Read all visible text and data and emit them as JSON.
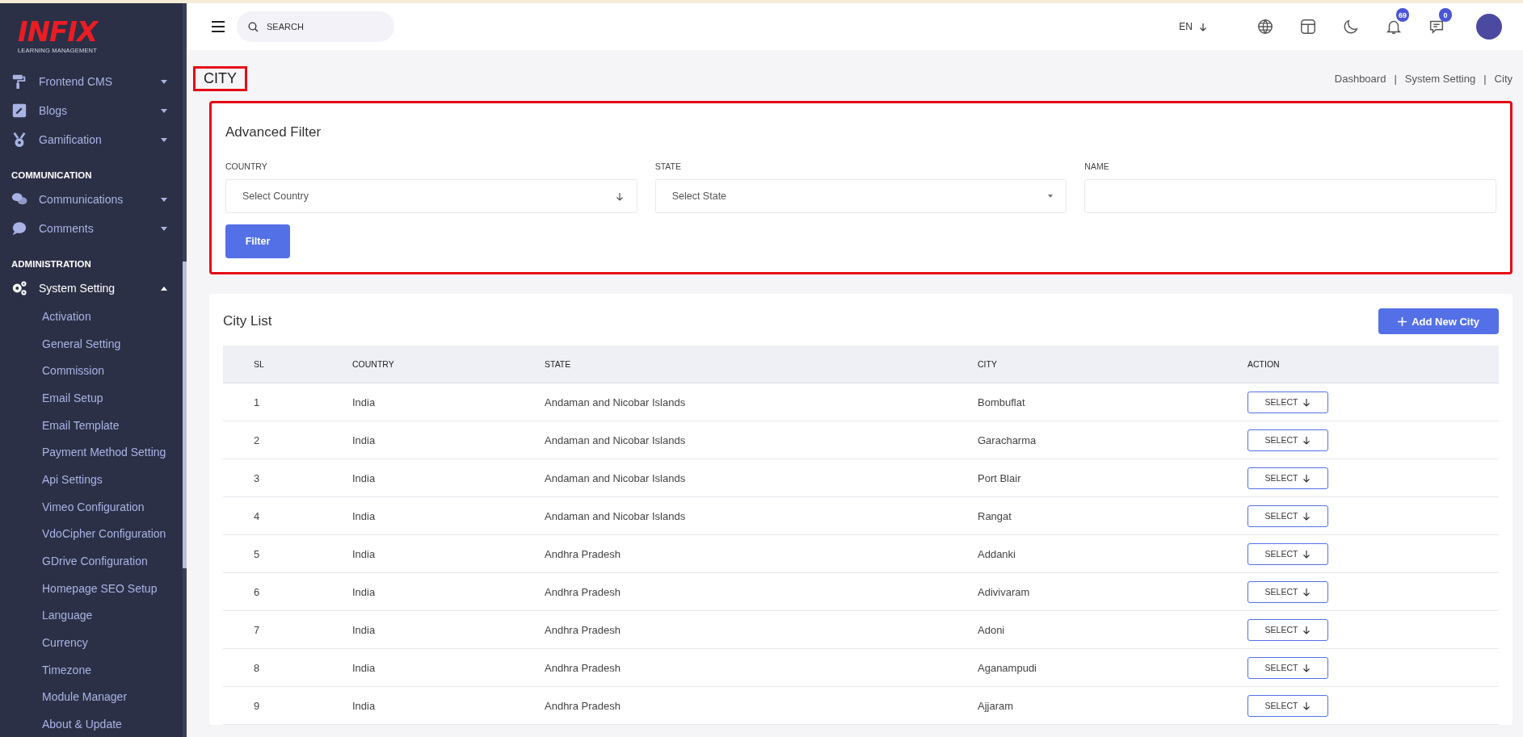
{
  "logo": {
    "wordmark": "INFIX",
    "tagline": "LEARNING MANAGEMENT"
  },
  "sidebar": {
    "sections": [
      {
        "items": [
          {
            "label": "Frontend CMS",
            "expanded": false
          },
          {
            "label": "Blogs",
            "expanded": false
          },
          {
            "label": "Gamification",
            "expanded": false
          }
        ]
      },
      {
        "heading": "COMMUNICATION",
        "items": [
          {
            "label": "Communications",
            "expanded": false
          },
          {
            "label": "Comments",
            "expanded": false
          }
        ]
      },
      {
        "heading": "ADMINISTRATION",
        "items": [
          {
            "label": "System Setting",
            "expanded": true,
            "children": [
              "Activation",
              "General Setting",
              "Commission",
              "Email Setup",
              "Email Template",
              "Payment Method Setting",
              "Api Settings",
              "Vimeo Configuration",
              "VdoCipher Configuration",
              "GDrive Configuration",
              "Homepage SEO Setup",
              "Language",
              "Currency",
              "Timezone",
              "Module Manager",
              "About & Update"
            ]
          }
        ]
      }
    ]
  },
  "header": {
    "search": {
      "placeholder": "SEARCH"
    },
    "language": "EN",
    "notifications_badge": "69",
    "messages_badge": "0"
  },
  "page": {
    "title": "CITY",
    "breadcrumb": [
      "Dashboard",
      "System Setting",
      "City"
    ],
    "breadcrumb_separator": "|"
  },
  "filter": {
    "title": "Advanced Filter",
    "fields": [
      {
        "label": "COUNTRY",
        "kind": "select-arrow",
        "placeholder": "Select Country"
      },
      {
        "label": "STATE",
        "kind": "select-caret",
        "placeholder": "Select State"
      },
      {
        "label": "NAME",
        "kind": "input"
      }
    ],
    "button": "Filter"
  },
  "city_list": {
    "title": "City List",
    "add_button": "Add New City",
    "columns": [
      "SL",
      "COUNTRY",
      "STATE",
      "CITY",
      "ACTION"
    ],
    "rows": [
      {
        "sl": "1",
        "country": "India",
        "state": "Andaman and Nicobar Islands",
        "city": "Bombuflat",
        "action": "SELECT"
      },
      {
        "sl": "2",
        "country": "India",
        "state": "Andaman and Nicobar Islands",
        "city": "Garacharma",
        "action": "SELECT"
      },
      {
        "sl": "3",
        "country": "India",
        "state": "Andaman and Nicobar Islands",
        "city": "Port Blair",
        "action": "SELECT"
      },
      {
        "sl": "4",
        "country": "India",
        "state": "Andaman and Nicobar Islands",
        "city": "Rangat",
        "action": "SELECT"
      },
      {
        "sl": "5",
        "country": "India",
        "state": "Andhra Pradesh",
        "city": "Addanki",
        "action": "SELECT"
      },
      {
        "sl": "6",
        "country": "India",
        "state": "Andhra Pradesh",
        "city": "Adivivaram",
        "action": "SELECT"
      },
      {
        "sl": "7",
        "country": "India",
        "state": "Andhra Pradesh",
        "city": "Adoni",
        "action": "SELECT"
      },
      {
        "sl": "8",
        "country": "India",
        "state": "Andhra Pradesh",
        "city": "Aganampudi",
        "action": "SELECT"
      },
      {
        "sl": "9",
        "country": "India",
        "state": "Andhra Pradesh",
        "city": "Ajjaram",
        "action": "SELECT"
      }
    ]
  }
}
